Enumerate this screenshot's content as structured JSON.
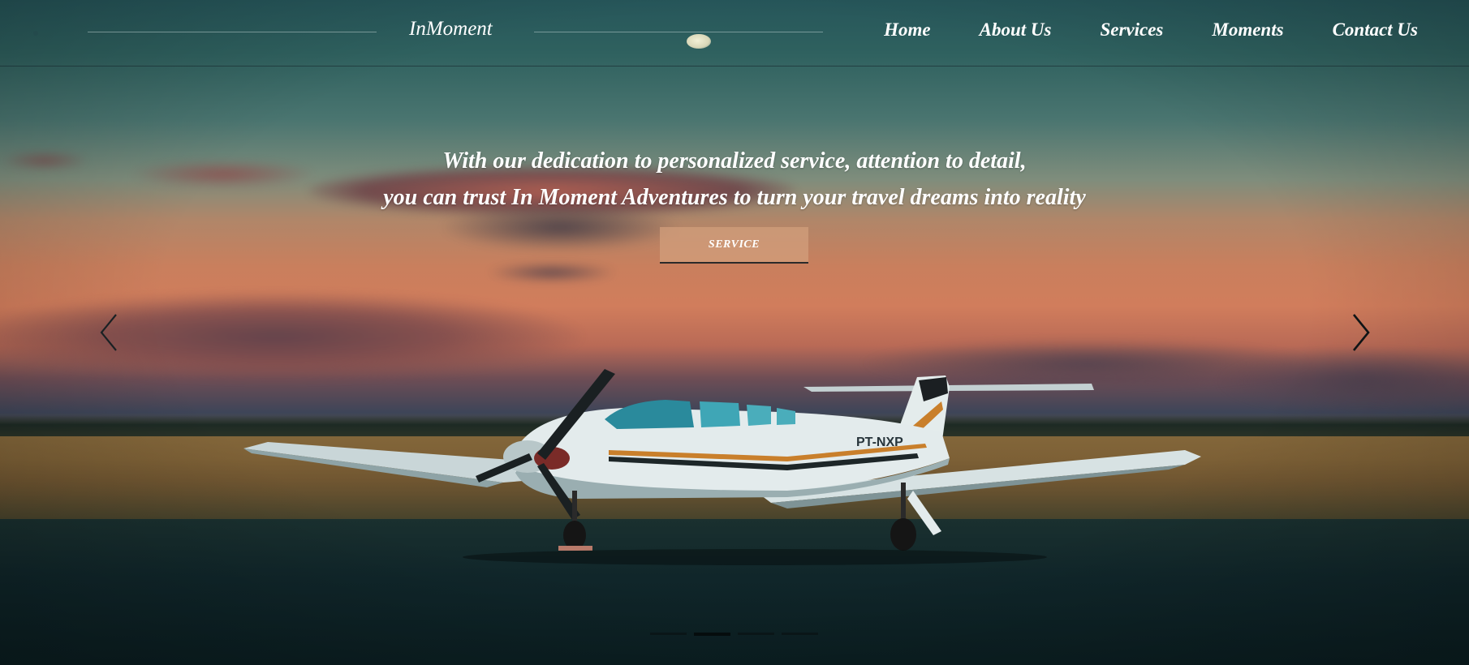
{
  "brand": {
    "name": "InMoment"
  },
  "nav": {
    "items": [
      {
        "label": "Home"
      },
      {
        "label": "About Us"
      },
      {
        "label": "Services"
      },
      {
        "label": "Moments"
      },
      {
        "label": "Contact Us"
      }
    ]
  },
  "hero": {
    "headline_line1": "With our dedication to personalized service, attention to detail,",
    "headline_line2": "you can trust In Moment Adventures to turn your travel dreams into reality",
    "cta_label": "SERVICE",
    "plane_registration": "PT-NXP"
  },
  "carousel": {
    "prev_icon": "chevron-left-icon",
    "next_icon": "chevron-right-icon",
    "slide_count": 4,
    "active_index": 1
  },
  "colors": {
    "cta_background": "#d2a07d",
    "text": "#ffffff",
    "indicator": "#0a1416"
  }
}
